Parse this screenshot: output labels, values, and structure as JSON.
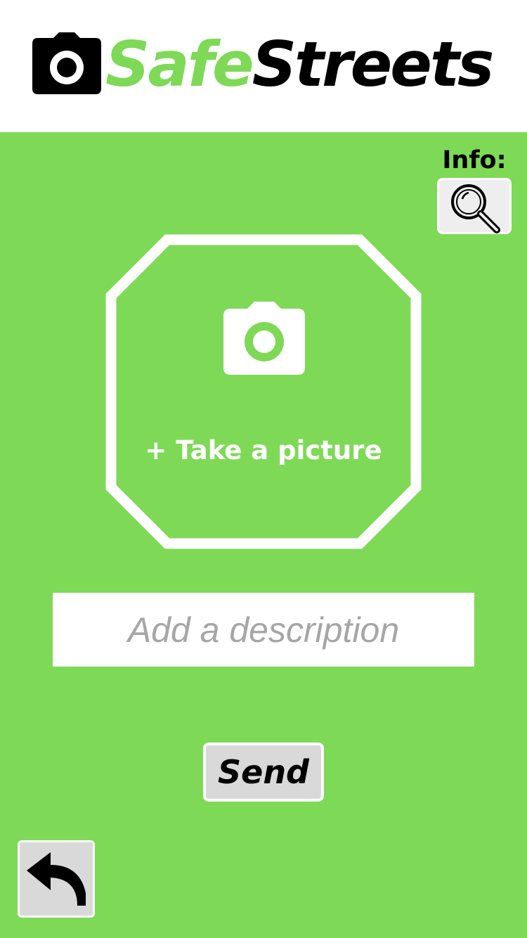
{
  "header": {
    "logo_icon": "camera-icon",
    "brand_part1": "Safe",
    "brand_part2": "Streets"
  },
  "info": {
    "label": "Info:",
    "icon": "magnifier-icon"
  },
  "picture": {
    "icon": "camera-icon",
    "label": "+ Take a picture"
  },
  "description": {
    "placeholder": "Add a description",
    "value": ""
  },
  "send": {
    "label": "Send"
  },
  "back": {
    "icon": "back-arrow-icon"
  },
  "colors": {
    "background": "#7ed957",
    "brand_green": "#7ed957",
    "button_gray": "#d9d9d9",
    "placeholder_gray": "#a6a6a6"
  }
}
